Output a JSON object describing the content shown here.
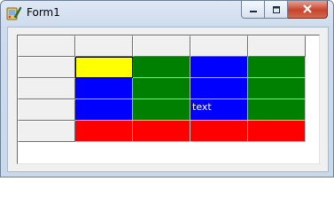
{
  "window": {
    "title": "Form1",
    "icon": "app-paint-icon"
  },
  "caption_buttons": {
    "minimize_icon": "minimize-icon",
    "maximize_icon": "maximize-icon",
    "close_icon": "close-icon"
  },
  "grid": {
    "rows": [
      [
        "header",
        "header",
        "header",
        "header",
        "header"
      ],
      [
        "header",
        "yellow",
        "green",
        "blue",
        "green"
      ],
      [
        "header",
        "blue",
        "green",
        "blue",
        "green"
      ],
      [
        "header",
        "blue",
        "green",
        "blue",
        "green"
      ],
      [
        "header",
        "red",
        "red",
        "red",
        "red"
      ]
    ],
    "cell_text": {
      "r3c3": "text"
    },
    "colors": {
      "yellow": "#ffff00",
      "green": "#008000",
      "blue": "#0000ff",
      "red": "#ff0000",
      "fixed": "#f0f0f0"
    }
  }
}
